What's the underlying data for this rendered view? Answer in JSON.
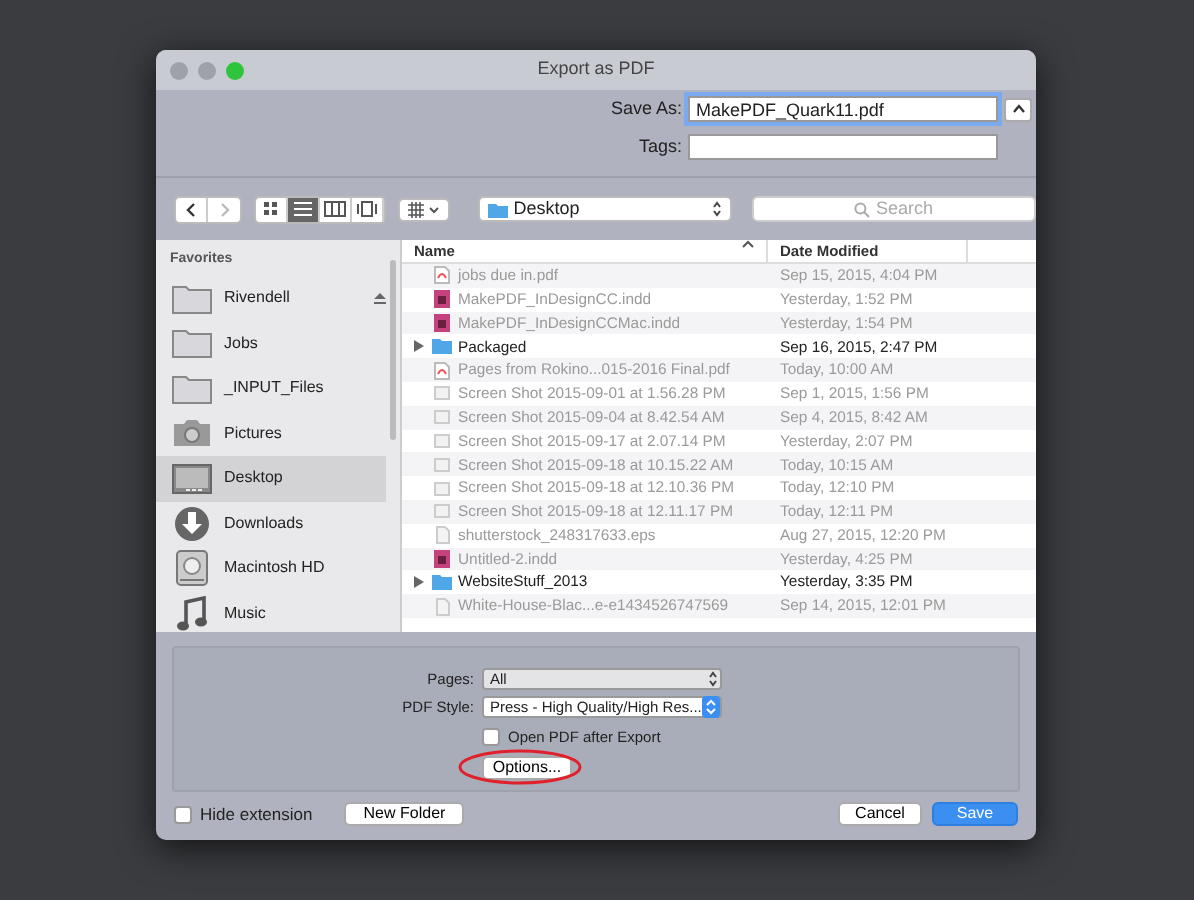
{
  "window": {
    "title": "Export as PDF"
  },
  "save_as": {
    "label": "Save As:",
    "value": "MakePDF_Quark11.pdf"
  },
  "tags": {
    "label": "Tags:"
  },
  "toolbar": {
    "location": "Desktop",
    "search": {
      "placeholder": "Search"
    },
    "views": [
      {
        "kind": "icons",
        "selected": false
      },
      {
        "kind": "list",
        "selected": true
      },
      {
        "kind": "columns",
        "selected": false
      },
      {
        "kind": "coverflow",
        "selected": false
      }
    ]
  },
  "sidebar": {
    "heading": "Favorites",
    "items": [
      {
        "label": "Rivendell",
        "kind": "folder",
        "selected": false,
        "eject": true
      },
      {
        "label": "Jobs",
        "kind": "folder",
        "selected": false,
        "eject": false
      },
      {
        "label": "_INPUT_Files",
        "kind": "folder",
        "selected": false,
        "eject": false
      },
      {
        "label": "Pictures",
        "kind": "camera",
        "selected": false,
        "eject": false
      },
      {
        "label": "Desktop",
        "kind": "desktop",
        "selected": true,
        "eject": false
      },
      {
        "label": "Downloads",
        "kind": "download",
        "selected": false,
        "eject": false
      },
      {
        "label": "Macintosh HD",
        "kind": "disk",
        "selected": false,
        "eject": false
      },
      {
        "label": "Music",
        "kind": "music",
        "selected": false,
        "eject": false
      }
    ]
  },
  "table": {
    "columns": [
      "Name",
      "Date Modified"
    ],
    "rows": [
      {
        "name": "jobs due in.pdf",
        "date": "Sep 15, 2015, 4:04 PM",
        "kind": "pdf",
        "enabled": false
      },
      {
        "name": "MakePDF_InDesignCC.indd",
        "date": "Yesterday, 1:52 PM",
        "kind": "indd",
        "enabled": false
      },
      {
        "name": "MakePDF_InDesignCCMac.indd",
        "date": "Yesterday, 1:54 PM",
        "kind": "indd",
        "enabled": false
      },
      {
        "name": "Packaged",
        "date": "Sep 16, 2015, 2:47 PM",
        "kind": "folder",
        "enabled": true
      },
      {
        "name": "Pages from Rokino...015-2016 Final.pdf",
        "date": "Today, 10:00 AM",
        "kind": "pdf",
        "enabled": false
      },
      {
        "name": "Screen Shot 2015-09-01 at 1.56.28 PM",
        "date": "Sep 1, 2015, 1:56 PM",
        "kind": "image",
        "enabled": false
      },
      {
        "name": "Screen Shot 2015-09-04 at 8.42.54 AM",
        "date": "Sep 4, 2015, 8:42 AM",
        "kind": "image",
        "enabled": false
      },
      {
        "name": "Screen Shot 2015-09-17 at 2.07.14 PM",
        "date": "Yesterday, 2:07 PM",
        "kind": "image",
        "enabled": false
      },
      {
        "name": "Screen Shot 2015-09-18 at 10.15.22 AM",
        "date": "Today, 10:15 AM",
        "kind": "image",
        "enabled": false
      },
      {
        "name": "Screen Shot 2015-09-18 at 12.10.36 PM",
        "date": "Today, 12:10 PM",
        "kind": "image",
        "enabled": false
      },
      {
        "name": "Screen Shot 2015-09-18 at 12.11.17 PM",
        "date": "Today, 12:11 PM",
        "kind": "image",
        "enabled": false
      },
      {
        "name": "shutterstock_248317633.eps",
        "date": "Aug 27, 2015, 12:20 PM",
        "kind": "doc",
        "enabled": false
      },
      {
        "name": "Untitled-2.indd",
        "date": "Yesterday, 4:25 PM",
        "kind": "indd",
        "enabled": false
      },
      {
        "name": "WebsiteStuff_2013",
        "date": "Yesterday, 3:35 PM",
        "kind": "folder",
        "enabled": true
      },
      {
        "name": "White-House-Blac...e-e1434526747569",
        "date": "Sep 14, 2015, 12:01 PM",
        "kind": "doc",
        "enabled": false
      }
    ]
  },
  "options": {
    "pages": {
      "label": "Pages:",
      "value": "All"
    },
    "pdf_style": {
      "label": "PDF Style:",
      "value": "Press - High Quality/High Res..."
    },
    "open_after": {
      "label": "Open PDF after Export",
      "checked": false
    },
    "options_button": "Options..."
  },
  "footer": {
    "hide_extension": {
      "label": "Hide extension",
      "checked": false
    },
    "new_folder": "New Folder",
    "cancel": "Cancel",
    "save": "Save"
  }
}
